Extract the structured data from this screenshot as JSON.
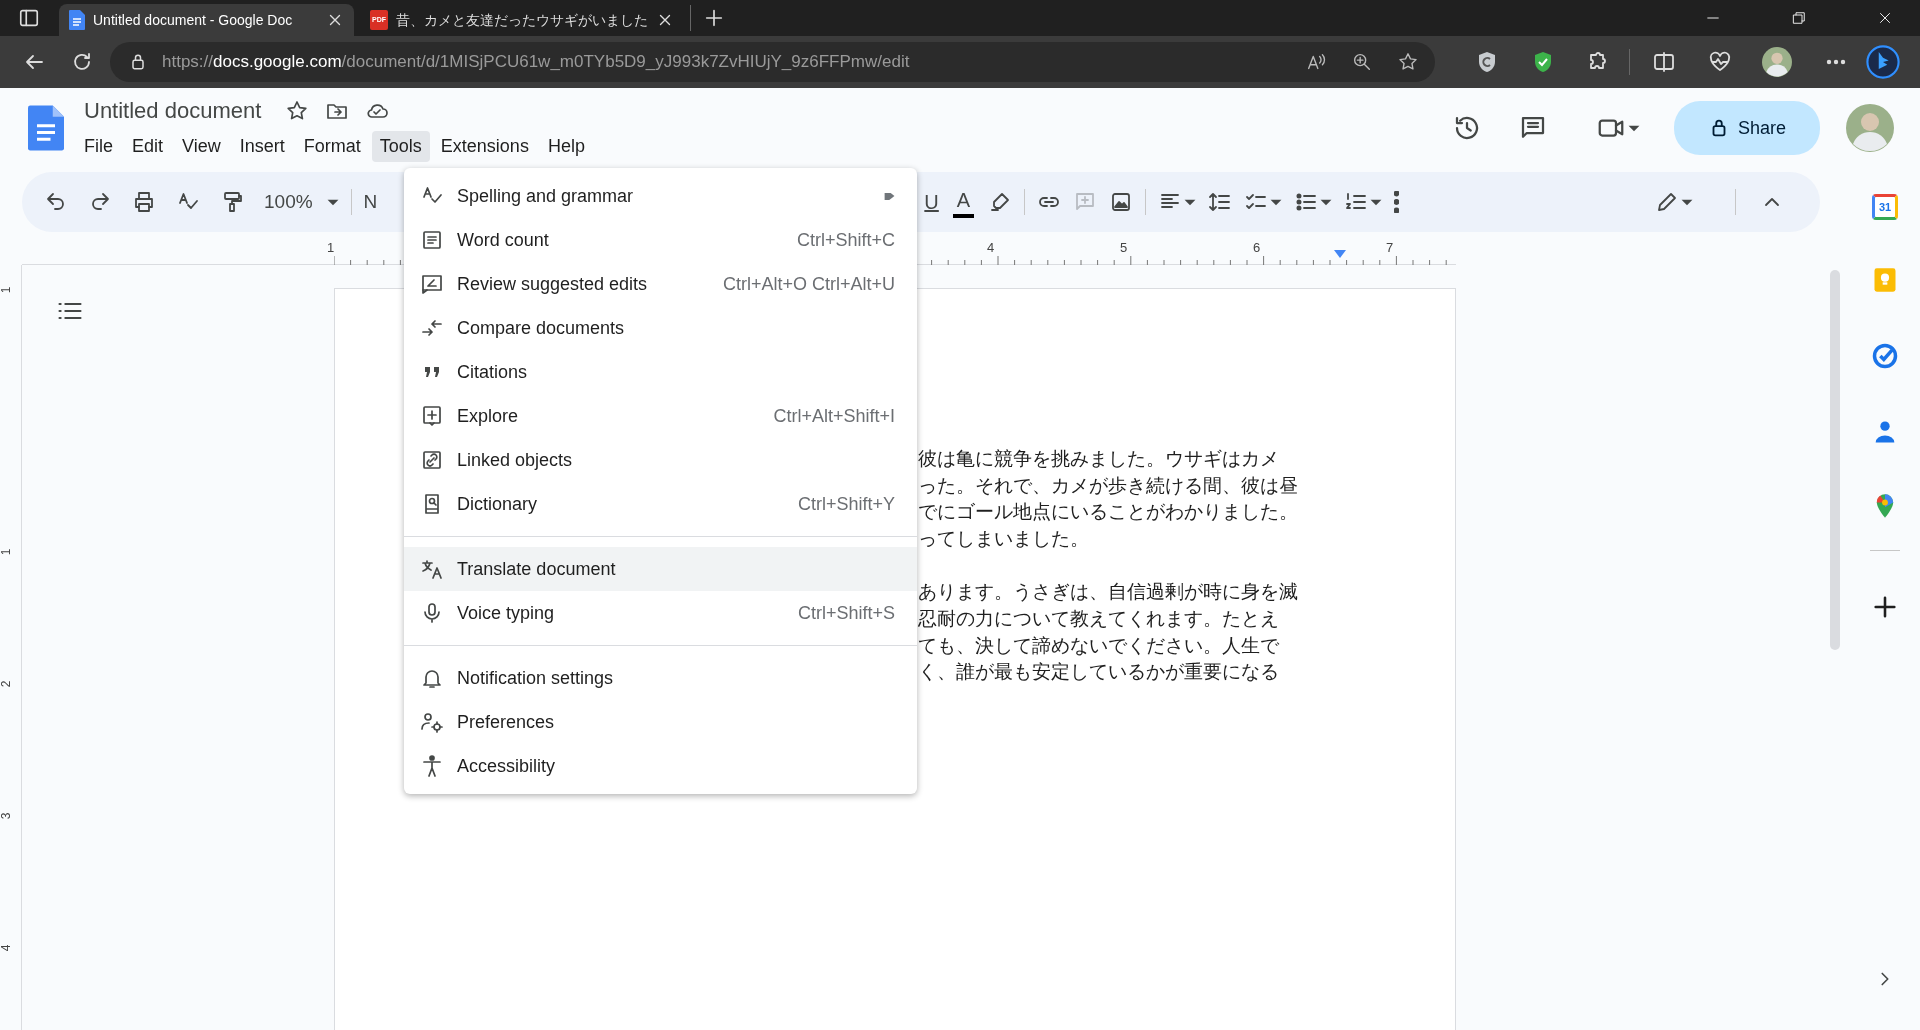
{
  "browser": {
    "tabs": [
      {
        "title": "Untitled document - Google Doc",
        "kind": "docs",
        "selected": true
      },
      {
        "title": "昔、カメと友達だったウサギがいました",
        "kind": "pdf",
        "badge": "PDF",
        "selected": false
      }
    ],
    "url": {
      "scheme": "https://",
      "host": "docs.google.com",
      "path": "/document/d/1MISjPCU61w_m0TYb5D9_yJ993k7ZvHIUjY_9z6FFPmw/edit"
    }
  },
  "docs": {
    "title": "Untitled document",
    "menubar": [
      {
        "label": "File",
        "selected": false
      },
      {
        "label": "Edit",
        "selected": false
      },
      {
        "label": "View",
        "selected": false
      },
      {
        "label": "Insert",
        "selected": false
      },
      {
        "label": "Format",
        "selected": false
      },
      {
        "label": "Tools",
        "selected": true
      },
      {
        "label": "Extensions",
        "selected": false
      },
      {
        "label": "Help",
        "selected": false
      }
    ],
    "share": "Share",
    "toolbar": {
      "zoom": "100%",
      "style": "N",
      "underline": "U",
      "text_color": "A",
      "add_comment_disabled": true
    },
    "ruler": [
      "1",
      "4",
      "5",
      "6",
      "7"
    ],
    "vertical_ruler": [
      "1",
      "1",
      "2",
      "3",
      "4"
    ],
    "tools_menu": [
      [
        {
          "kind": "spelling",
          "label": "Spelling and grammar",
          "submenu": true,
          "selected": false
        },
        {
          "kind": "word-count",
          "label": "Word count",
          "shortcut": "Ctrl+Shift+C",
          "selected": false
        },
        {
          "kind": "review",
          "label": "Review suggested edits",
          "shortcut": "Ctrl+Alt+O Ctrl+Alt+U",
          "selected": false
        },
        {
          "kind": "compare",
          "label": "Compare documents",
          "selected": false
        },
        {
          "kind": "citations",
          "label": "Citations",
          "selected": false
        },
        {
          "kind": "explore",
          "label": "Explore",
          "shortcut": "Ctrl+Alt+Shift+I",
          "selected": false
        },
        {
          "kind": "linked",
          "label": "Linked objects",
          "selected": false
        },
        {
          "kind": "dictionary",
          "label": "Dictionary",
          "shortcut": "Ctrl+Shift+Y",
          "selected": false
        }
      ],
      [
        {
          "kind": "translate",
          "label": "Translate document",
          "selected": true
        },
        {
          "kind": "mic",
          "label": "Voice typing",
          "shortcut": "Ctrl+Shift+S",
          "selected": false
        }
      ],
      [
        {
          "kind": "bell",
          "label": "Notification settings",
          "selected": false
        },
        {
          "kind": "preferences",
          "label": "Preferences",
          "selected": false
        },
        {
          "kind": "accessibility",
          "label": "Accessibility",
          "selected": false
        }
      ]
    ],
    "paragraphs": [
      [
        "彼は亀に競争を挑みました。ウサギはカメ",
        "った。それで、カメが歩き続ける間、彼は昼",
        "でにゴール地点にいることがわかりました。",
        "ってしまいました。"
      ],
      [
        "あります。うさぎは、自信過剰が時に身を滅",
        "忍耐の力について教えてくれます。たとえ",
        "ても、決して諦めないでください。人生で",
        "く、誰が最も安定しているかが重要になる"
      ]
    ],
    "side_panel": {
      "calendar_label": "31"
    }
  }
}
